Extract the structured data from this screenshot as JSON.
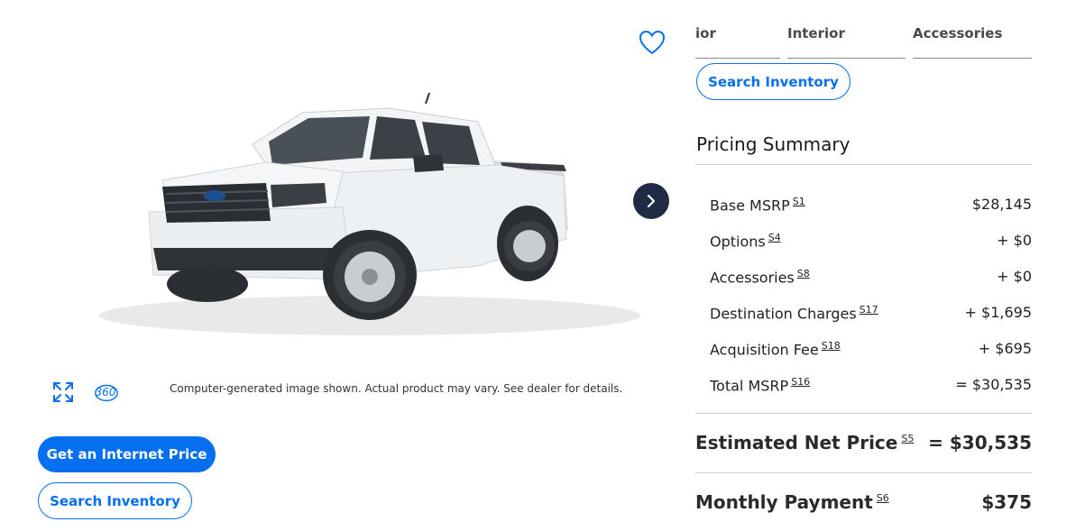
{
  "tabs": [
    {
      "label": "ior"
    },
    {
      "label": "Interior"
    },
    {
      "label": "Accessories"
    }
  ],
  "panel": {
    "search_label": "Search Inventory",
    "summary_title": "Pricing Summary",
    "rows": [
      {
        "label": "Base MSRP",
        "note": "S1",
        "value": "$28,145"
      },
      {
        "label": "Options",
        "note": "S4",
        "value": "+ $0"
      },
      {
        "label": "Accessories",
        "note": "S8",
        "value": "+ $0"
      },
      {
        "label": "Destination Charges",
        "note": "S17",
        "value": "+ $1,695"
      },
      {
        "label": "Acquisition Fee",
        "note": "S18",
        "value": "+ $695"
      },
      {
        "label": "Total MSRP",
        "note": "S16",
        "value": "= $30,535"
      }
    ],
    "net_price": {
      "label": "Estimated Net Price",
      "note": "S5",
      "value": "= $30,535"
    },
    "monthly": {
      "label": "Monthly Payment",
      "note": "S6",
      "value": "$375"
    }
  },
  "vehicle": {
    "disclaimer": "Computer-generated image shown. Actual product may vary. See dealer for details.",
    "badge_360": "360"
  },
  "actions": {
    "internet_price_label": "Get an Internet Price",
    "search_label": "Search Inventory"
  },
  "colors": {
    "accent": "#066fef",
    "nav_button": "#1f2a44",
    "truck_body": "#eef1f4"
  },
  "icons": [
    "heart-icon",
    "chevron-right-icon",
    "expand-icon",
    "rotate-360-icon"
  ]
}
